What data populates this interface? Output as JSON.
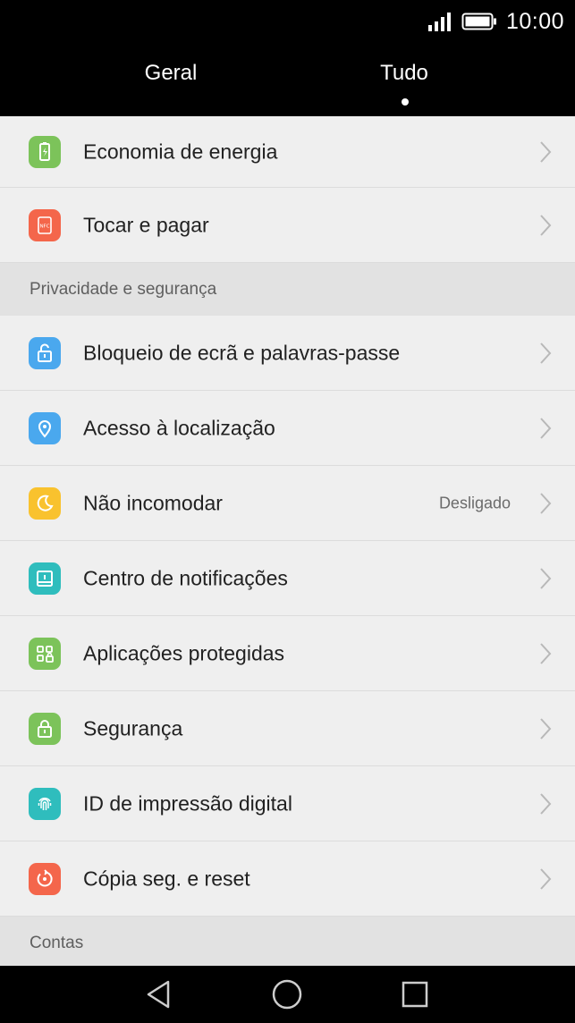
{
  "status": {
    "time": "10:00"
  },
  "tabs": [
    {
      "label": "Geral"
    },
    {
      "label": "Tudo",
      "active": true
    }
  ],
  "items_top": [
    {
      "label": "Economia de energia",
      "icon": "battery-saver-icon",
      "color": "#7cc35a"
    },
    {
      "label": "Tocar e pagar",
      "icon": "nfc-icon",
      "icon_text": "NFC",
      "color": "#f4664b"
    }
  ],
  "section_privacy": {
    "title": "Privacidade e segurança"
  },
  "items_privacy": [
    {
      "label": "Bloqueio de ecrã e palavras-passe",
      "icon": "unlock-icon",
      "color": "#4aa8ee"
    },
    {
      "label": "Acesso à localização",
      "icon": "location-pin-icon",
      "color": "#4aa8ee"
    },
    {
      "label": "Não incomodar",
      "value": "Desligado",
      "icon": "moon-icon",
      "color": "#f9c22e"
    },
    {
      "label": "Centro de notificações",
      "icon": "notification-center-icon",
      "color": "#2fbdbd"
    },
    {
      "label": "Aplicações protegidas",
      "icon": "protected-apps-icon",
      "color": "#7cc35a"
    },
    {
      "label": "Segurança",
      "icon": "lock-icon",
      "color": "#7cc35a"
    },
    {
      "label": "ID de impressão digital",
      "icon": "fingerprint-icon",
      "color": "#2fbdbd"
    },
    {
      "label": "Cópia seg. e reset",
      "icon": "backup-reset-icon",
      "color": "#f4664b"
    }
  ],
  "section_accounts": {
    "title": "Contas"
  }
}
